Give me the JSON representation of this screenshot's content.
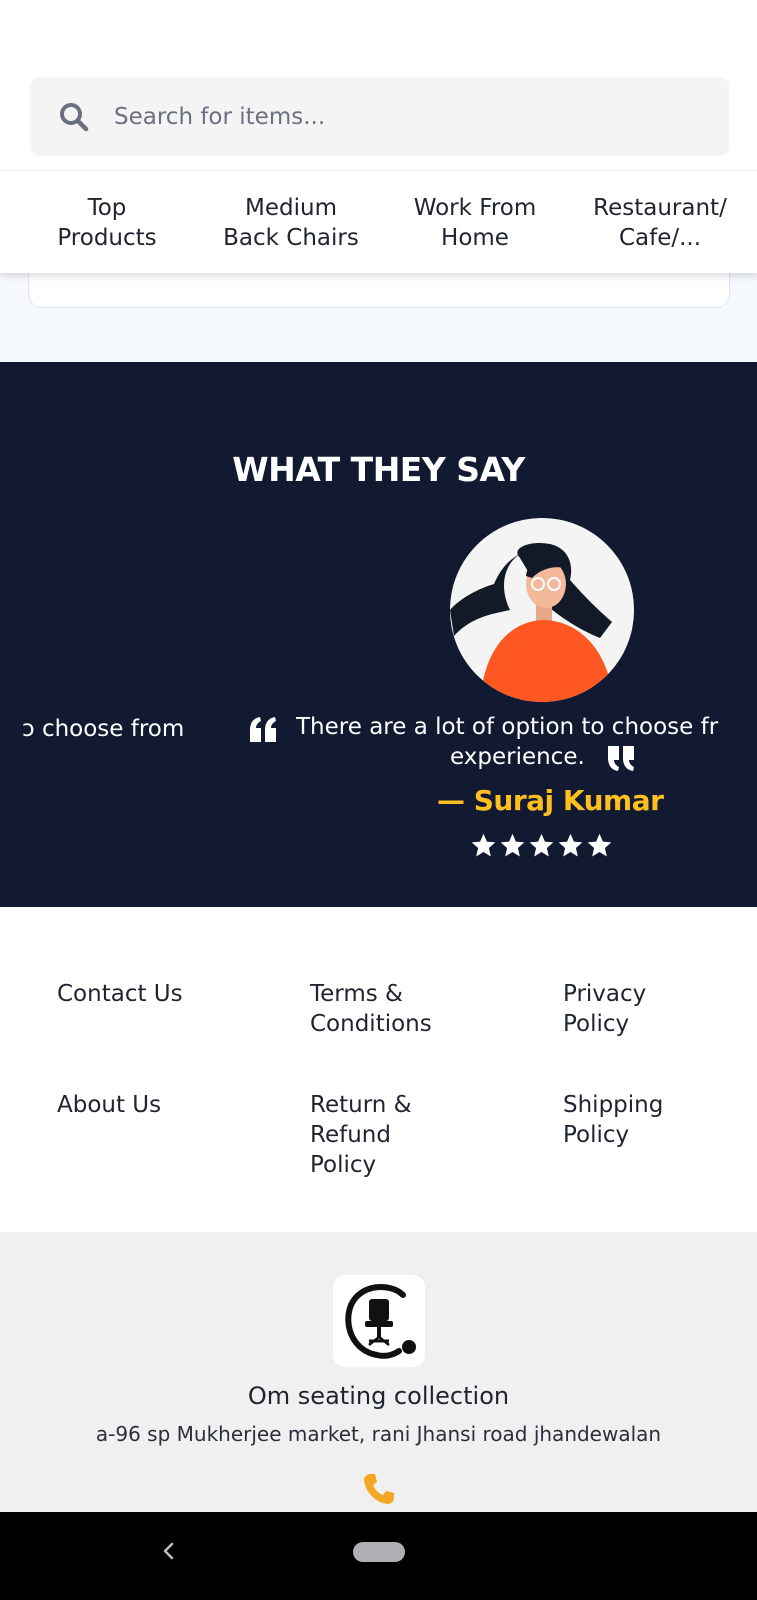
{
  "search": {
    "placeholder": "Search for items..."
  },
  "categories": [
    {
      "line1": "Top",
      "line2": "Products"
    },
    {
      "line1": "Medium",
      "line2": "Back Chairs"
    },
    {
      "line1": "Work From",
      "line2": "Home"
    },
    {
      "line1": "Restaurant/",
      "line2": "Cafe/..."
    }
  ],
  "testimonials": {
    "title": "WHAT THEY SAY",
    "prev_fragment": "ɔ choose from",
    "quote_line1": "There are a lot of option to choose fr",
    "quote_line2": "experience.",
    "author": "— Suraj Kumar",
    "rating": 5,
    "star_color": "#ffffff",
    "author_color": "#ffbf1f",
    "background": "#111a31"
  },
  "footer_links": [
    {
      "lines": [
        "Contact Us"
      ]
    },
    {
      "lines": [
        "Terms &",
        "Conditions"
      ]
    },
    {
      "lines": [
        "Privacy",
        "Policy"
      ]
    },
    {
      "lines": [
        "About Us"
      ]
    },
    {
      "lines": [
        "Return &",
        "Refund",
        "Policy"
      ]
    },
    {
      "lines": [
        "Shipping",
        "Policy"
      ]
    }
  ],
  "company": {
    "name": "Om seating collection",
    "address": "a-96 sp Mukherjee market, rani Jhansi road jhandewalan",
    "logo_icon": "office-chair-logo",
    "contact_icon": "phone-icon",
    "accent": "#f5a623"
  },
  "system_nav": {
    "back_icon": "chevron-left-icon",
    "home_icon": "home-pill"
  }
}
